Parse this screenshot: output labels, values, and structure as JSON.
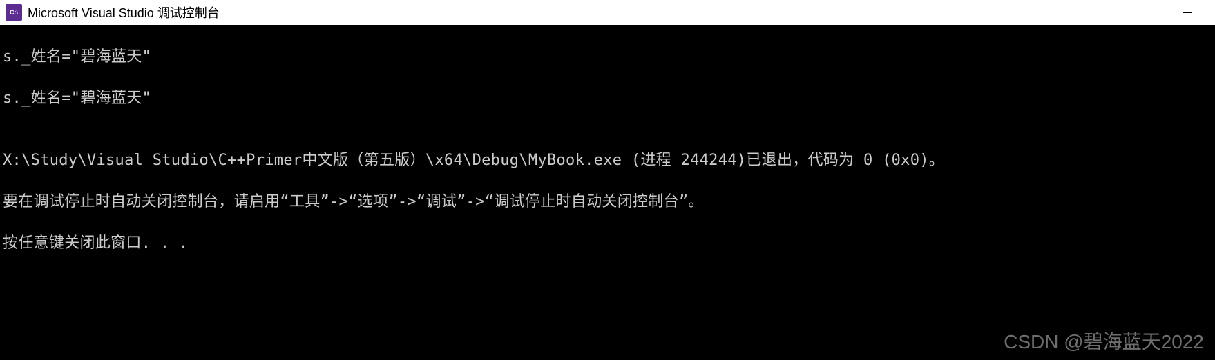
{
  "titlebar": {
    "icon_text": "C:\\",
    "title": "Microsoft Visual Studio 调试控制台"
  },
  "console": {
    "line1": "s._姓名=\"碧海蓝天\"",
    "line2": "s._姓名=\"碧海蓝天\"",
    "blank1": "",
    "line3": "X:\\Study\\Visual Studio\\C++Primer中文版（第五版）\\x64\\Debug\\MyBook.exe (进程 244244)已退出，代码为 0 (0x0)。",
    "line4": "要在调试停止时自动关闭控制台，请启用“工具”->“选项”->“调试”->“调试停止时自动关闭控制台”。",
    "line5": "按任意键关闭此窗口. . ."
  },
  "watermark": "CSDN @碧海蓝天2022"
}
